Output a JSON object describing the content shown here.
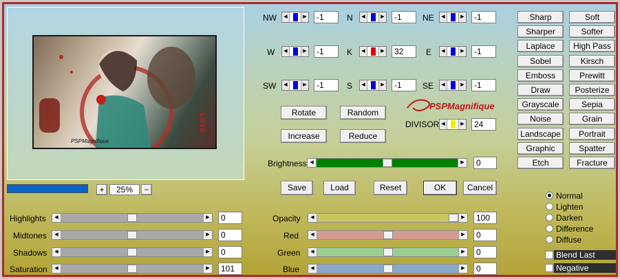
{
  "kernel": {
    "NW": {
      "label": "NW",
      "value": "-1"
    },
    "N": {
      "label": "N",
      "value": "-1"
    },
    "NE": {
      "label": "NE",
      "value": "-1"
    },
    "W": {
      "label": "W",
      "value": "-1"
    },
    "K": {
      "label": "K",
      "value": "32"
    },
    "E": {
      "label": "E",
      "value": "-1"
    },
    "SW": {
      "label": "SW",
      "value": "-1"
    },
    "S": {
      "label": "S",
      "value": "-1"
    },
    "SE": {
      "label": "SE",
      "value": "-1"
    }
  },
  "divisor": {
    "label": "DIVISOR",
    "value": "24"
  },
  "actions": {
    "rotate": "Rotate",
    "random": "Random",
    "increase": "Increase",
    "reduce": "Reduce"
  },
  "logo_text": "PSPMagnifique",
  "brightness": {
    "label": "Brightness",
    "value": "0",
    "level": 0.5
  },
  "preview": {
    "zoom": "25%",
    "zoom_in": "+",
    "zoom_out": "−",
    "credit": "PSPMagnifique",
    "love": "LOVE"
  },
  "dialog": {
    "save": "Save",
    "load": "Load",
    "reset": "Reset",
    "ok": "OK",
    "cancel": "Cancel"
  },
  "presets": [
    [
      "Sharp",
      "Soft"
    ],
    [
      "Sharper",
      "Softer"
    ],
    [
      "Laplace",
      "High Pass"
    ],
    [
      "Sobel",
      "Kirsch"
    ],
    [
      "Emboss",
      "Prewitt"
    ],
    [
      "Draw",
      "Posterize"
    ],
    [
      "Grayscale",
      "Sepia"
    ],
    [
      "Noise",
      "Grain"
    ],
    [
      "Landscape",
      "Portrait"
    ],
    [
      "Graphic",
      "Spatter"
    ],
    [
      "Etch",
      "Fracture"
    ]
  ],
  "tones": {
    "highlights": {
      "label": "Highlights",
      "value": "0",
      "level": 0.5
    },
    "midtones": {
      "label": "Midtones",
      "value": "0",
      "level": 0.5
    },
    "shadows": {
      "label": "Shadows",
      "value": "0",
      "level": 0.5
    },
    "saturation": {
      "label": "Saturation",
      "value": "101",
      "level": 0.5
    }
  },
  "channels": {
    "opacity": {
      "label": "Opacity",
      "value": "100",
      "level": 1.0,
      "color": "#c9c764"
    },
    "red": {
      "label": "Red",
      "value": "0",
      "level": 0.5,
      "color": "#d59a94"
    },
    "green": {
      "label": "Green",
      "value": "0",
      "level": 0.5,
      "color": "#9ccf8f"
    },
    "blue": {
      "label": "Blue",
      "value": "0",
      "level": 0.5,
      "color": "#8aa8c8"
    }
  },
  "blend_modes": {
    "normal": "Normal",
    "lighten": "Lighten",
    "darken": "Darken",
    "difference": "Difference",
    "diffuse": "Diffuse",
    "selected": "Normal"
  },
  "options": {
    "blend_last": "Blend Last",
    "negative": "Negative"
  },
  "colors": {
    "frame_red": "#b02828",
    "brightness_green": "#008000",
    "spin_blue": "#0000e0",
    "spin_red": "#e00000",
    "divisor_yellow": "#f0f000",
    "progress_blue": "#0a64c8"
  }
}
